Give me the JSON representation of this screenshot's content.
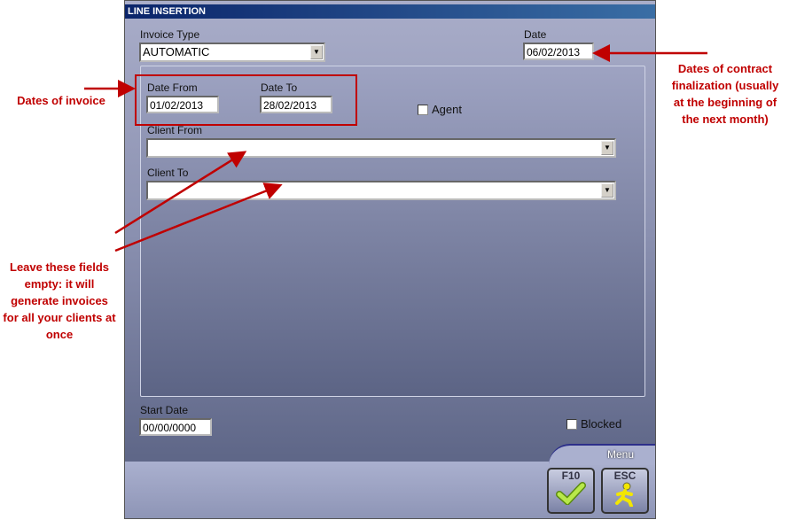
{
  "window": {
    "title": "LINE INSERTION"
  },
  "form": {
    "invoice_type_label": "Invoice Type",
    "invoice_type_value": "AUTOMATIC",
    "date_label": "Date",
    "date_value": "06/02/2013",
    "date_from_label": "Date From",
    "date_from_value": "01/02/2013",
    "date_to_label": "Date To",
    "date_to_value": "28/02/2013",
    "agent_label": "Agent",
    "agent_checked": false,
    "client_from_label": "Client From",
    "client_from_value": "",
    "client_to_label": "Client To",
    "client_to_value": "",
    "start_date_label": "Start Date",
    "start_date_value": "00/00/0000",
    "blocked_label": "Blocked",
    "blocked_checked": false
  },
  "menu": {
    "label": "Menu",
    "f10_label": "F10",
    "esc_label": "ESC",
    "f10_icon": "checkmark-icon",
    "esc_icon": "running-man-icon"
  },
  "annotations": {
    "dates_of_invoice": "Dates of invoice",
    "contract_dates": "Dates of contract finalization (usually at the beginning of the next month)",
    "leave_empty": "Leave these fields empty: it will generate invoices for all your clients at once"
  },
  "colors": {
    "annotation": "#c00000",
    "title_bar": "#0a246a"
  }
}
